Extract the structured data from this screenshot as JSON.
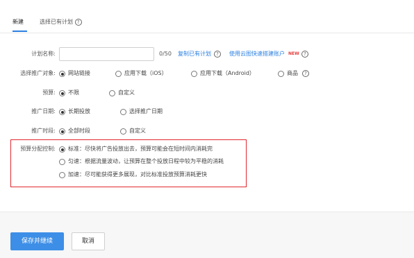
{
  "tabs": {
    "new_label": "新建",
    "select_existing_label": "选择已有计划"
  },
  "form": {
    "plan_name": {
      "label": "计划名称:",
      "value": "",
      "counter": "0/50",
      "copy_link": "复制已有计划",
      "cloud_link": "使用云图快速搭建账户",
      "new_badge": "NEW"
    },
    "promotion_target": {
      "label": "选择推广对象:",
      "options": [
        "网站链接",
        "应用下载（iOS）",
        "应用下载（Android）",
        "商品"
      ],
      "selected": "网站链接"
    },
    "budget": {
      "label": "预算:",
      "options": [
        "不限",
        "自定义"
      ],
      "selected": "不限"
    },
    "promotion_date": {
      "label": "推广日期:",
      "options": [
        "长期投放",
        "选择推广日期"
      ],
      "selected": "长期投放"
    },
    "promotion_time": {
      "label": "推广时段:",
      "options": [
        "全部时段",
        "自定义"
      ],
      "selected": "全部时段"
    },
    "budget_control": {
      "label": "预算分配控制:",
      "options": [
        "标准：尽快将广告投放出去，预算可能会在短时间内消耗完",
        "匀速：根据流量波动，让预算在整个投放日程中较为平稳的消耗",
        "加速：尽可能获得更多展现，对比标准投放预算消耗更快"
      ],
      "selected": "标准：尽快将广告投放出去，预算可能会在短时间内消耗完"
    }
  },
  "footer": {
    "save_label": "保存并继续",
    "cancel_label": "取消"
  },
  "icons": {
    "help": "question-circle-icon"
  },
  "colors": {
    "accent": "#3d8ee6",
    "link": "#2a7fe0",
    "highlight_border": "#e0262c",
    "new_badge": "#e23b3b"
  }
}
